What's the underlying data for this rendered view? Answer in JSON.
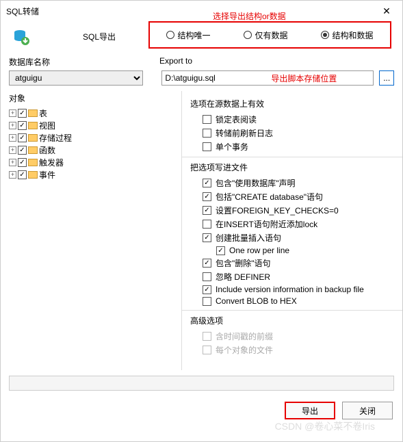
{
  "window": {
    "title": "SQL转储",
    "close": "✕"
  },
  "toolbar": {
    "export_label": "SQL导出"
  },
  "annotations": {
    "top": "选择导出结构or数据",
    "path": "导出脚本存储位置"
  },
  "radios": {
    "r1": "结构唯一",
    "r2": "仅有数据",
    "r3": "结构和数据"
  },
  "labels": {
    "dbname": "数据库名称",
    "exportto": "Export to",
    "objects": "对象"
  },
  "values": {
    "dbselect": "atguigu",
    "exportpath": "D:\\atguigu.sql",
    "dots": "..."
  },
  "tree": {
    "i0": "表",
    "i1": "视图",
    "i2": "存储过程",
    "i3": "函数",
    "i4": "触发器",
    "i5": "事件"
  },
  "groups": {
    "g1": "选项在源数据上有效",
    "g2": "把选项写进文件",
    "g3": "高级选项"
  },
  "opts": {
    "o1": "锁定表阅读",
    "o2": "转储前刷新日志",
    "o3": "单个事务",
    "o4": "包含\"使用数据库\"声明",
    "o5": "包括\"CREATE database\"语句",
    "o6": "设置FOREIGN_KEY_CHECKS=0",
    "o7": "在INSERT语句附近添加lock",
    "o8": "创建批量插入语句",
    "o9": "One row per line",
    "o10": "包含\"删除\"语句",
    "o11": "忽略 DEFINER",
    "o12": "Include version information in backup file",
    "o13": "Convert BLOB to HEX",
    "o14": "含时间戳的前缀",
    "o15": "每个对象的文件"
  },
  "buttons": {
    "export": "导出",
    "close": "关闭"
  },
  "watermark": "CSDN @卷心菜不卷Iris"
}
